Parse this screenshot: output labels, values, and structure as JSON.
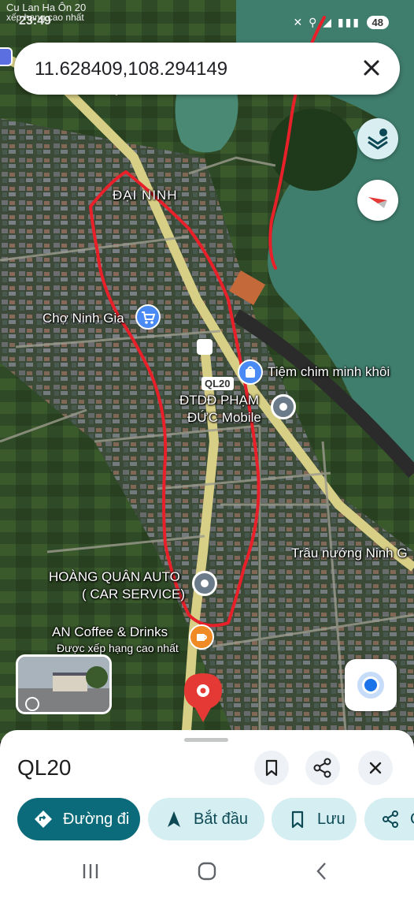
{
  "status_bar": {
    "title_top": "Cu Lan Ha Ôn 20",
    "sub_top": "xếp hạng cao nhất",
    "time": "23:49",
    "battery": "48"
  },
  "search": {
    "query": "11.628409,108.294149"
  },
  "map_labels": {
    "area": "ĐẠI NINH",
    "market": "Chợ Ninh Gia",
    "bird_shop": "Tiệm chim minh khôi",
    "phone_shop_line1": "ĐTDĐ PHẠM",
    "phone_shop_line2": "ĐỨC Mobile",
    "road_shield": "QL20",
    "grill": "Trâu nướng Ninh G",
    "auto_line1": "HOÀNG QUÂN AUTO",
    "auto_line2": "( CAR SERVICE)",
    "coffee": "AN Coffee & Drinks",
    "coffee_sub": "Được xếp hạng cao nhất"
  },
  "icons": {
    "layers": "layers-icon",
    "compass": "compass-icon",
    "my_location": "my-location-icon",
    "place_pin": "red-place-pin-icon"
  },
  "sheet": {
    "place_name": "QL20",
    "actions": {
      "directions": "Đường đi",
      "start": "Bắt đầu",
      "save": "Lưu",
      "share": "C"
    }
  },
  "colors": {
    "accent": "#0b6b7b",
    "pin_red": "#e53935",
    "drawn_outline": "#e8202a"
  }
}
